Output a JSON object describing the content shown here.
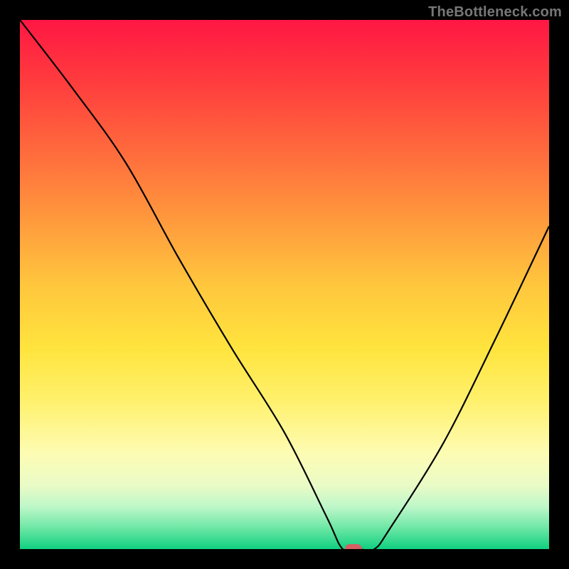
{
  "watermark": "TheBottleneck.com",
  "colors": {
    "background": "#000000",
    "gradient_top": "#ff1744",
    "gradient_mid": "#ffe43d",
    "gradient_bottom": "#10d080",
    "curve": "#000000",
    "marker": "#dd5a63"
  },
  "chart_data": {
    "type": "line",
    "title": "",
    "xlabel": "",
    "ylabel": "",
    "xlim": [
      0,
      100
    ],
    "ylim": [
      0,
      100
    ],
    "x": [
      0,
      10,
      20,
      30,
      40,
      50,
      58,
      61,
      64,
      67,
      70,
      80,
      90,
      100
    ],
    "values": [
      100,
      87,
      73,
      55,
      38,
      22,
      6,
      0,
      0,
      0,
      4,
      20,
      40,
      61
    ],
    "marker": {
      "x": 63,
      "y": 0
    }
  }
}
